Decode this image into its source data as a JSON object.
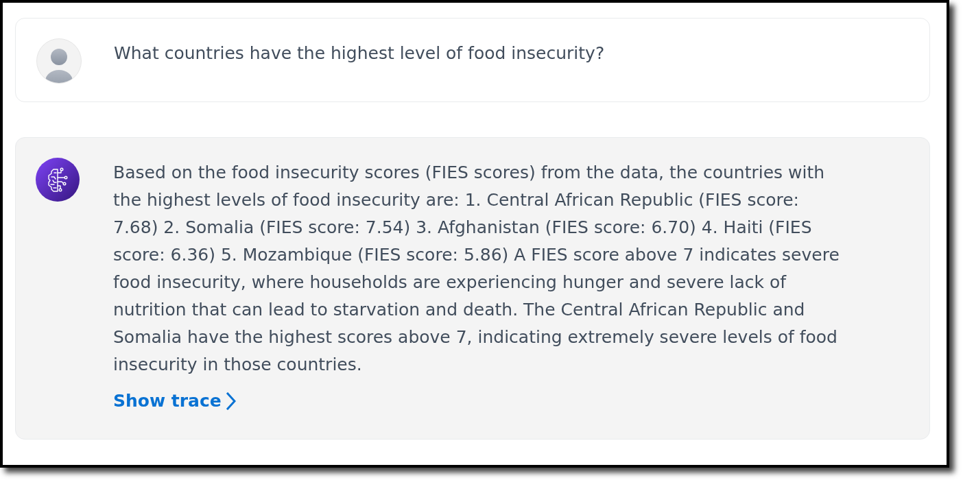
{
  "messages": [
    {
      "kind": "user",
      "text": "What countries have the highest level of food insecurity?"
    },
    {
      "kind": "assistant",
      "text": "Based on the food insecurity scores (FIES scores) from the data, the countries with the highest levels of food insecurity are: 1. Central African Republic (FIES score: 7.68) 2. Somalia (FIES score: 7.54) 3. Afghanistan (FIES score: 6.70) 4. Haiti (FIES score: 6.36) 5. Mozambique (FIES score: 5.86) A FIES score above 7 indicates severe food insecurity, where households are experiencing hunger and severe lack of nutrition that can lead to starvation and death. The Central African Republic and Somalia have the highest scores above 7, indicating extremely severe levels of food insecurity in those countries.",
      "trace_link": "Show trace"
    }
  ]
}
